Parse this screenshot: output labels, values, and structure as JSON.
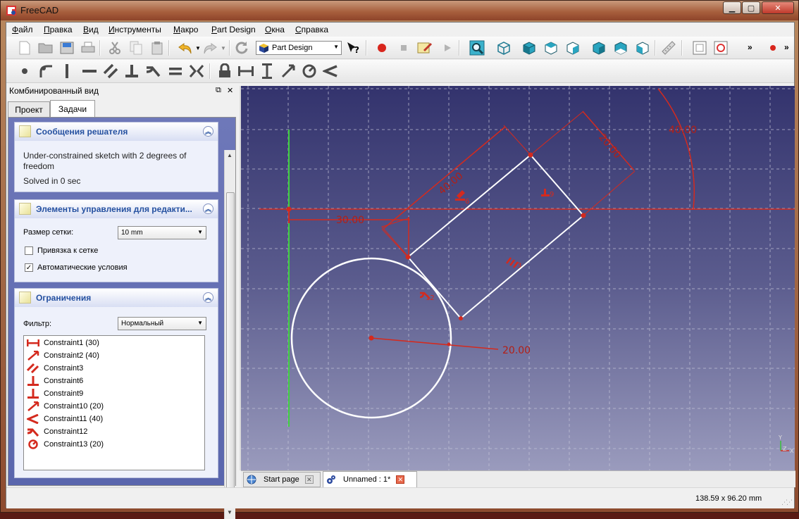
{
  "window": {
    "title": "FreeCAD"
  },
  "menu": [
    "Файл",
    "Правка",
    "Вид",
    "Инструменты",
    "Макро",
    "Part Design",
    "Окна",
    "Справка"
  ],
  "toolbar": {
    "workbench": "Part Design"
  },
  "panel": {
    "title": "Комбинированный вид",
    "tabs": [
      "Проект",
      "Задачи"
    ],
    "active_tab": "Задачи"
  },
  "solver": {
    "title": "Сообщения решателя",
    "message": "Under-constrained sketch with 2 degrees of freedom",
    "time": "Solved in 0 sec"
  },
  "edit_controls": {
    "title": "Элементы управления для редакти...",
    "grid_size_label": "Размер сетки:",
    "grid_size_value": "10 mm",
    "snap_label": "Привязка к сетке",
    "snap_checked": false,
    "auto_constraints_label": "Автоматические условия",
    "auto_constraints_checked": true
  },
  "constraints": {
    "title": "Ограничения",
    "filter_label": "Фильтр:",
    "filter_value": "Нормальный",
    "items": [
      {
        "label": "Constraint1 (30)",
        "icon": "horizontal-distance-icon"
      },
      {
        "label": "Constraint2 (40)",
        "icon": "distance-icon"
      },
      {
        "label": "Constraint3",
        "icon": "parallel-icon"
      },
      {
        "label": "Constraint6",
        "icon": "perpendicular-icon"
      },
      {
        "label": "Constraint9",
        "icon": "perpendicular-icon"
      },
      {
        "label": "Constraint10 (20)",
        "icon": "distance-icon"
      },
      {
        "label": "Constraint11 (40)",
        "icon": "angle-icon"
      },
      {
        "label": "Constraint12",
        "icon": "tangent-icon"
      },
      {
        "label": "Constraint13 (20)",
        "icon": "radius-icon"
      }
    ]
  },
  "sketch": {
    "dim_30": "30.00",
    "dim_40": "40.00",
    "dim_20a": "20.00",
    "dim_angle": "40.00",
    "dim_radius": "20.00",
    "label_6a": "6",
    "label_9": "9",
    "label_3": "3",
    "label_12": "12",
    "axis_x": "X",
    "axis_y": "Y",
    "axis_z": "Z"
  },
  "doc_tabs": [
    "Start page",
    "Unnamed : 1*"
  ],
  "status": {
    "coords": "138.59 x 96.20 mm"
  },
  "colors": {
    "constraint_red": "#d42a1e",
    "sketch_white": "#ffffff",
    "accent_blue": "#2450a0"
  }
}
